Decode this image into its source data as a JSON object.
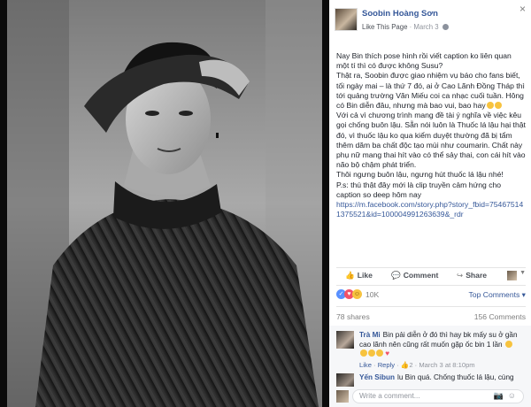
{
  "page": {
    "name": "Soobin Hoàng Sơn",
    "like_label": "Like This Page",
    "date": "March 3",
    "close_glyph": "×"
  },
  "caption": {
    "p1": "Nay Bin thích pose hình rồi viết caption ko liên quan một tí thì có được không Susu?",
    "p2": "Thật ra, Soobin được giao nhiệm vụ báo cho fans biết, tối ngày mai – là thứ 7 đó, ai ở Cao Lãnh Đồng Tháp thì tới quảng trường Văn Miếu coi ca nhạc cuối tuần. Hông có Bin diễn đâu, nhưng mà bao vui, bao hay",
    "p3": "Với cả vì chương trình mang đề tài ý nghĩa về việc kêu gọi chống buôn lậu. Sẵn nói luôn là Thuốc lá lậu hại thật đó, vì thuốc lậu ko qua kiểm duyệt thường đã bị tẩm thêm dăm ba chất độc tạo mùi như coumarin. Chất này phụ nữ mang thai hít vào có thể sảy thai, con cái hít vào não bộ chậm phát triển.",
    "p4": "Thôi ngưng buôn lậu, ngưng hút thuốc lá lậu nhé!",
    "p5": "P.s: thú thật đây mới là clip truyền cảm hứng cho caption so deep hôm nay",
    "link": "https://m.facebook.com/story.php?story_fbid=754675141375521&id=100004991263639&_rdr"
  },
  "actions": {
    "like": "Like",
    "comment": "Comment",
    "share": "Share"
  },
  "reactions": {
    "count": "10K",
    "top_comments": "Top Comments ▾"
  },
  "stats": {
    "shares": "78 shares",
    "comments": "156 Comments"
  },
  "comments": [
    {
      "author": "Trà Mi",
      "text": "Bin pải diễn ở đó thì hay bk mấy su ở gần cao lãnh nên cũng rất muốn gặp ốc bin 1 lần",
      "meta_like": "Like",
      "meta_reply": "Reply",
      "meta_count": "2",
      "meta_time": "March 3 at 8:10pm"
    },
    {
      "author": "Yến Sibun",
      "text": "lu Bin quá. Chống thuốc lá lậu, cùng"
    }
  ],
  "composer": {
    "placeholder": "Write a comment..."
  },
  "icons": {
    "thumb": "👍",
    "comment": "💬",
    "share": "↪",
    "camera": "📷",
    "smile": "☺"
  },
  "colors": {
    "link_blue": "#365899",
    "like_blue": "#5890ff",
    "love_red": "#f25268",
    "haha_yellow": "#f7c33f"
  }
}
